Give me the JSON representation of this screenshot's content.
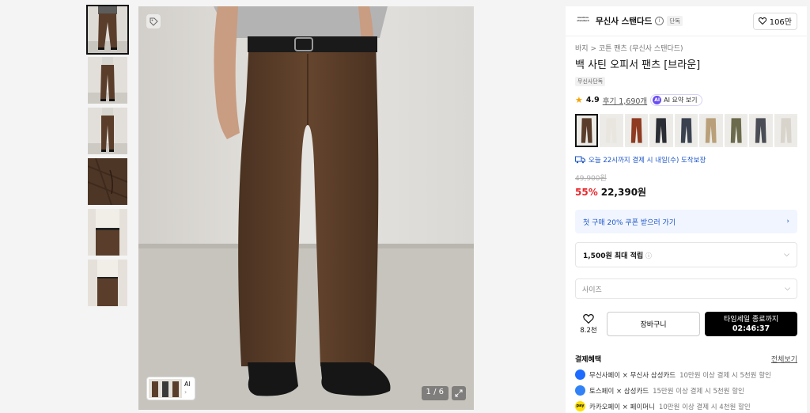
{
  "gallery": {
    "counter": "1 / 6",
    "ai_chip_label": "AI"
  },
  "brand": {
    "logo_text": "musinsa standard",
    "name": "무신사 스탠다드",
    "badge": "단독",
    "likes": "106만"
  },
  "product": {
    "breadcrumb_1": "바지",
    "breadcrumb_sep": ">",
    "breadcrumb_2": "코튼 팬츠 (무신사 스탠다드)",
    "title": "백 사틴 오피서 팬츠 [브라운]",
    "exclusive_badge": "무신사단독",
    "rating": "4.9",
    "reviews": "후기 1,690개",
    "ai_summary_label": "AI 요약 보기",
    "ai_icon_text": "AI"
  },
  "swatch_colors": [
    "#5a3e2b",
    "#e9e6df",
    "#8e3b22",
    "#2a2d33",
    "#3a4250",
    "#b9a07a",
    "#6b6a4c",
    "#4a4d55",
    "#d8d4cc"
  ],
  "delivery": "오늘 22시까지 결제 시 내일(수) 도착보장",
  "pricing": {
    "original": "49,900원",
    "discount": "55%",
    "price": "22,390원"
  },
  "coupon": "첫 구매 20% 쿠폰 받으러 가기",
  "points": {
    "label": "1,500원 최대 적립"
  },
  "size_select": {
    "placeholder": "사이즈"
  },
  "actions": {
    "wish_count": "8.2천",
    "cart": "장바구니",
    "buy_line1": "타임세일 종료까지",
    "buy_timer": "02:46:37"
  },
  "payment": {
    "title": "결제혜택",
    "more": "전체보기",
    "rows": [
      {
        "name": "무신사페이 × 무신사 삼성카드",
        "desc": "10만원 이상 결제 시 5천원 할인",
        "icon_color": "#1e6bff"
      },
      {
        "name": "토스페이 × 삼성카드",
        "desc": "15만원 이상 결제 시 5천원 할인",
        "icon_color": "#3182f6"
      },
      {
        "name": "카카오페이 × 페이머니",
        "desc": "10만원 이상 결제 시 4천원 할인",
        "icon_color": "#ffe000",
        "icon_text": "pay"
      }
    ]
  }
}
